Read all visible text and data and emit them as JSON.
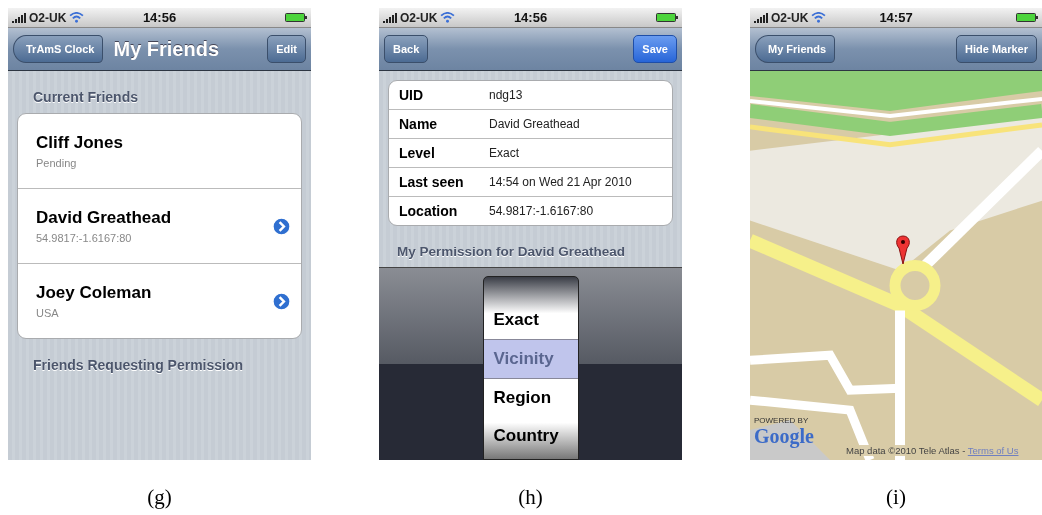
{
  "figures": [
    {
      "kind": "friends",
      "caption": "(g)",
      "status_bar": {
        "carrier": "O2-UK",
        "time": "14:56"
      },
      "nav_bar": {
        "left_button": {
          "label": "TrAmS Clock",
          "kind": "back"
        },
        "title": "My Friends",
        "right_button": {
          "label": "Edit",
          "kind": "plain"
        }
      },
      "sections": [
        {
          "header": "Current Friends",
          "rows": [
            {
              "name": "Cliff Jones",
              "detail": "Pending",
              "disclosure": false
            },
            {
              "name": "David Greathead",
              "detail": "54.9817:-1.6167:80",
              "disclosure": true
            },
            {
              "name": "Joey Coleman",
              "detail": "USA",
              "disclosure": true
            }
          ]
        },
        {
          "header": "Friends Requesting Permission"
        }
      ]
    },
    {
      "kind": "details",
      "caption": "(h)",
      "status_bar": {
        "carrier": "O2-UK",
        "time": "14:56"
      },
      "nav_bar": {
        "left_button": {
          "label": "Back",
          "kind": "plain"
        },
        "right_button": {
          "label": "Save",
          "kind": "done"
        }
      },
      "fields": [
        {
          "label": "UID",
          "value": "ndg13"
        },
        {
          "label": "Name",
          "value": "David Greathead"
        },
        {
          "label": "Level",
          "value": "Exact"
        },
        {
          "label": "Last seen",
          "value": "14:54 on Wed 21 Apr 2010"
        },
        {
          "label": "Location",
          "value": "54.9817:-1.6167:80"
        }
      ],
      "picker_header": "My Permission for David Greathead",
      "picker_options": [
        {
          "label": "Exact",
          "selected": false
        },
        {
          "label": "Vicinity",
          "selected": true
        },
        {
          "label": "Region",
          "selected": false
        },
        {
          "label": "Country",
          "selected": false
        }
      ]
    },
    {
      "kind": "map",
      "caption": "(i)",
      "status_bar": {
        "carrier": "O2-UK",
        "time": "14:57"
      },
      "nav_bar": {
        "left_button": {
          "label": "My Friends",
          "kind": "back"
        },
        "right_button": {
          "label": "Hide Marker",
          "kind": "plain"
        }
      },
      "logo": {
        "tagline": "POWERED BY",
        "name": "Google"
      },
      "attribution": {
        "text": "Map data ©2010 Tele Atlas - ",
        "link": "Terms of Us"
      }
    }
  ]
}
